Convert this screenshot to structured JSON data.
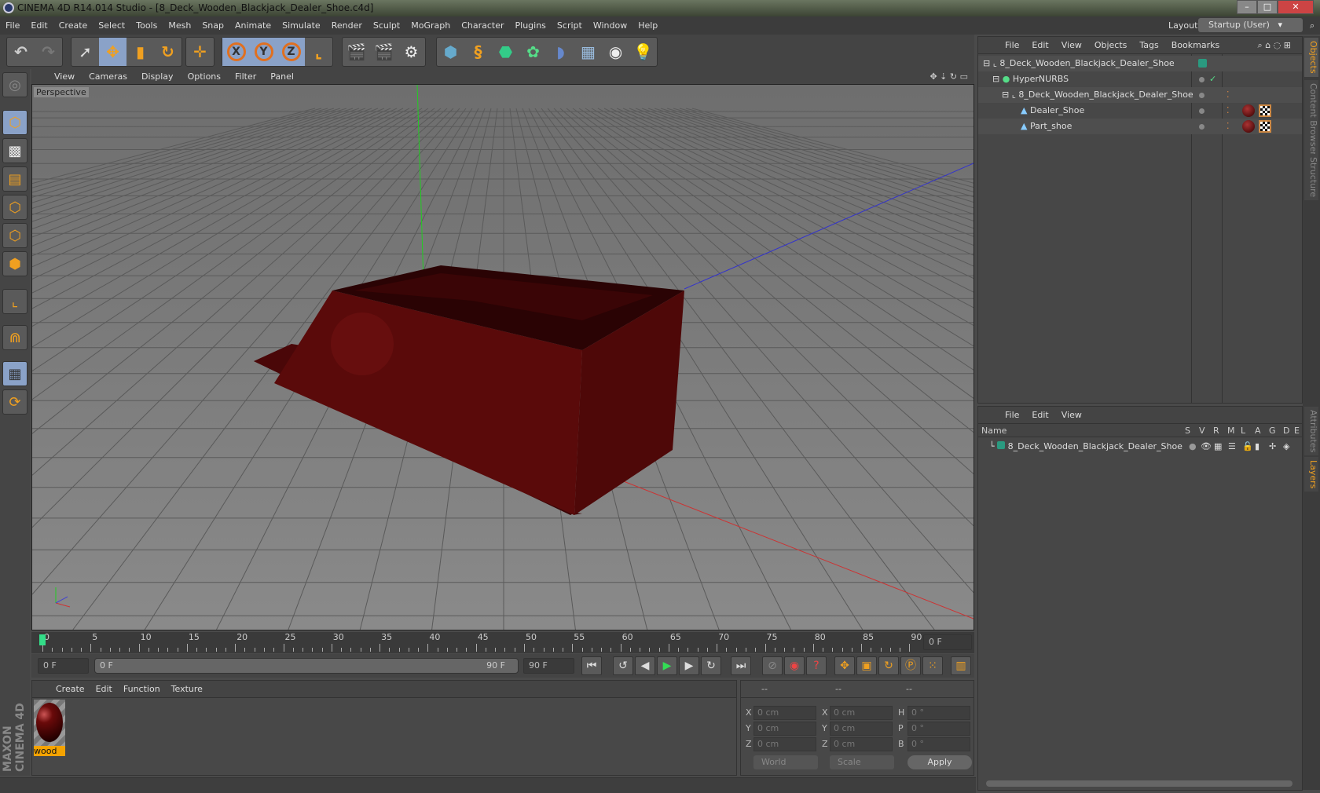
{
  "window": {
    "title": "CINEMA 4D R14.014 Studio - [8_Deck_Wooden_Blackjack_Dealer_Shoe.c4d]"
  },
  "menu": [
    "File",
    "Edit",
    "Create",
    "Select",
    "Tools",
    "Mesh",
    "Snap",
    "Animate",
    "Simulate",
    "Render",
    "Sculpt",
    "MoGraph",
    "Character",
    "Plugins",
    "Script",
    "Window",
    "Help"
  ],
  "layout": {
    "label": "Layout:",
    "value": "Startup (User)"
  },
  "toolbar": {
    "axis_x": "X",
    "axis_y": "Y",
    "axis_z": "Z"
  },
  "viewport": {
    "menu": [
      "View",
      "Cameras",
      "Display",
      "Options",
      "Filter",
      "Panel"
    ],
    "label": "Perspective"
  },
  "timeline": {
    "ticks": [
      "0",
      "5",
      "10",
      "15",
      "20",
      "25",
      "30",
      "35",
      "40",
      "45",
      "50",
      "55",
      "60",
      "65",
      "70",
      "75",
      "80",
      "85",
      "90"
    ],
    "current_frame": "0 F",
    "start": "0 F",
    "range_start": "0 F",
    "range_end": "90 F",
    "end": "90 F"
  },
  "materials": {
    "menu": [
      "Create",
      "Edit",
      "Function",
      "Texture"
    ],
    "items": [
      {
        "name": "wood"
      }
    ]
  },
  "coordinates": {
    "headers": [
      "--",
      "--",
      "--"
    ],
    "pos": [
      {
        "axis": "X",
        "value": "0 cm"
      },
      {
        "axis": "Y",
        "value": "0 cm"
      },
      {
        "axis": "Z",
        "value": "0 cm"
      }
    ],
    "size": [
      {
        "axis": "X",
        "value": "0 cm"
      },
      {
        "axis": "Y",
        "value": "0 cm"
      },
      {
        "axis": "Z",
        "value": "0 cm"
      }
    ],
    "rot": [
      {
        "axis": "H",
        "value": "0 °"
      },
      {
        "axis": "P",
        "value": "0 °"
      },
      {
        "axis": "B",
        "value": "0 °"
      }
    ],
    "mode1": "World",
    "mode2": "Scale",
    "apply": "Apply"
  },
  "objects": {
    "menu": [
      "File",
      "Edit",
      "View",
      "Objects",
      "Tags",
      "Bookmarks"
    ],
    "tree": [
      {
        "name": "8_Deck_Wooden_Blackjack_Dealer_Shoe",
        "level": 0
      },
      {
        "name": "HyperNURBS",
        "level": 1
      },
      {
        "name": "8_Deck_Wooden_Blackjack_Dealer_Shoe",
        "level": 2
      },
      {
        "name": "Dealer_Shoe",
        "level": 3
      },
      {
        "name": "Part_shoe",
        "level": 3
      }
    ]
  },
  "layers": {
    "menu": [
      "File",
      "Edit",
      "View"
    ],
    "columns": [
      "Name",
      "S",
      "V",
      "R",
      "M",
      "L",
      "A",
      "G",
      "D",
      "E"
    ],
    "rows": [
      {
        "name": "8_Deck_Wooden_Blackjack_Dealer_Shoe",
        "color": "#2a9a80"
      }
    ]
  },
  "side_tabs": [
    "Objects",
    "Content Browser",
    "Structure",
    "Attributes",
    "Layers"
  ],
  "brand": "MAXON CINEMA 4D",
  "colors": {
    "accent": "#f0a020",
    "layer": "#2a9a80",
    "object": "#5a0a0a"
  }
}
